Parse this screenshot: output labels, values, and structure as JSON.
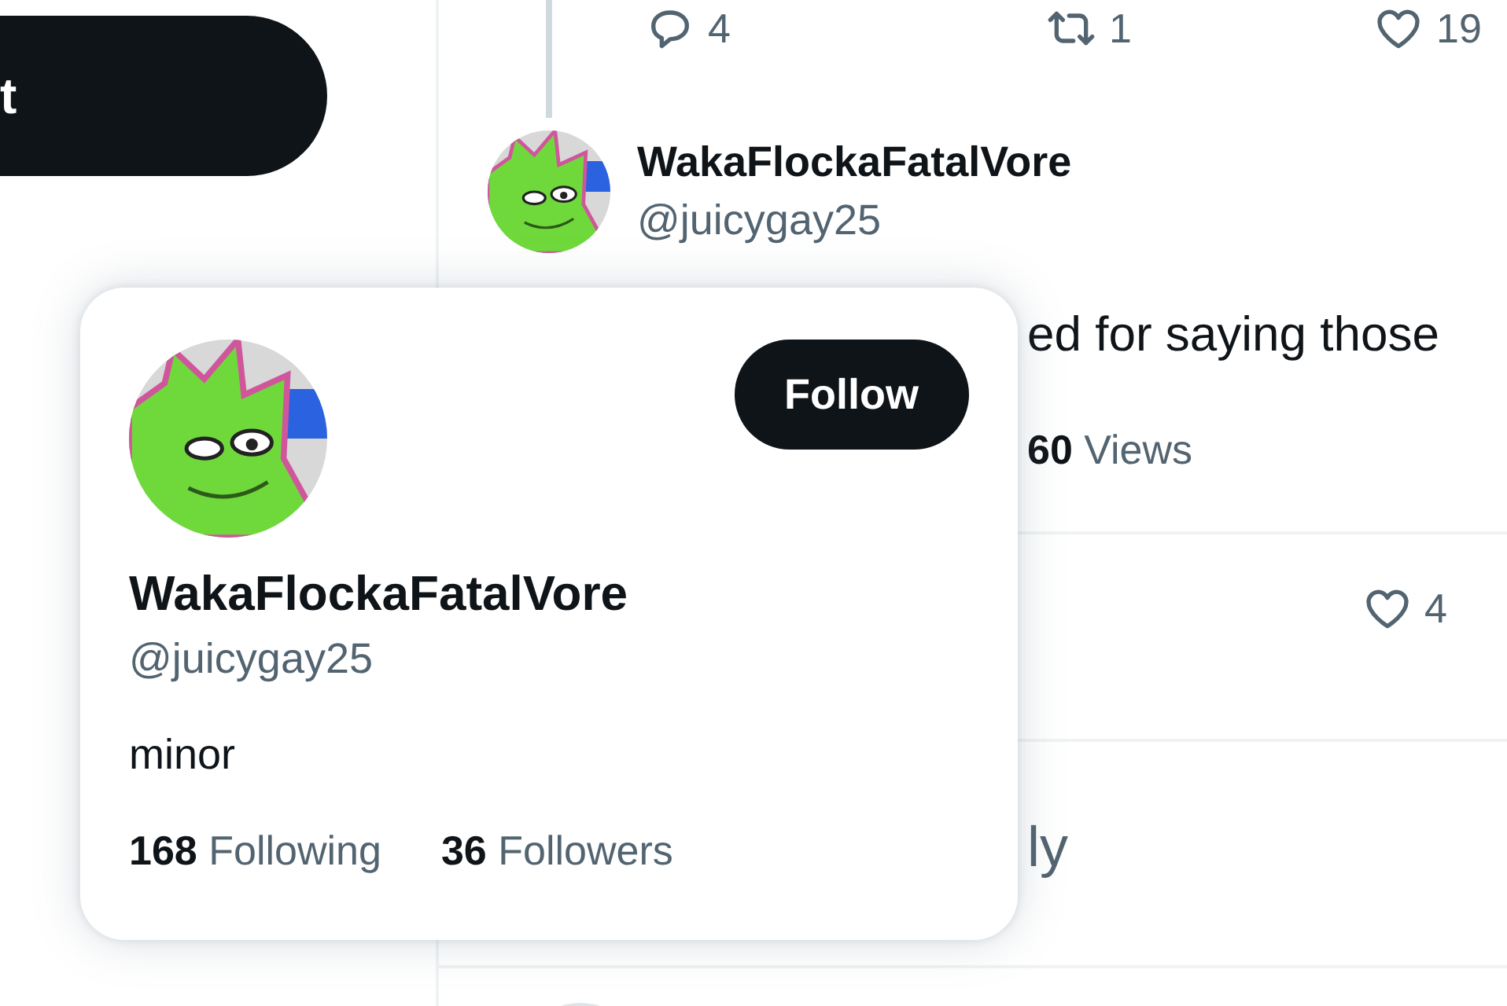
{
  "sidebar": {
    "button_label": "t"
  },
  "thread": {
    "parent_actions": [
      {
        "kind": "reply",
        "count": "4"
      },
      {
        "kind": "repost",
        "count": "1"
      },
      {
        "kind": "like",
        "count": "19"
      }
    ],
    "tweet": {
      "author": {
        "name": "WakaFlockaFatalVore",
        "handle": "@juicygay25"
      },
      "text": "ed for saying those",
      "views": {
        "count": "60",
        "label": "Views"
      },
      "actions": [
        {
          "kind": "like",
          "count": "4"
        }
      ]
    },
    "reply_box": {
      "placeholder": "ly"
    }
  },
  "hover_card": {
    "follow_button": "Follow",
    "name": "WakaFlockaFatalVore",
    "handle": "@juicygay25",
    "bio": "minor",
    "stats": [
      {
        "count": "168",
        "label": "Following"
      },
      {
        "count": "36",
        "label": "Followers"
      }
    ]
  }
}
